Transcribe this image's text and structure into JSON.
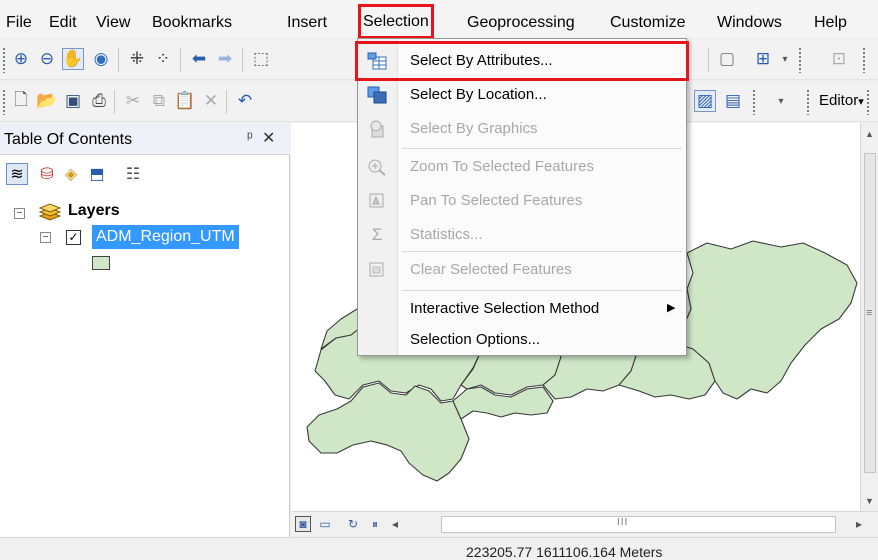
{
  "menu": {
    "items": [
      "File",
      "Edit",
      "View",
      "Bookmarks",
      "Insert",
      "Selection",
      "Geoprocessing",
      "Customize",
      "Windows",
      "Help"
    ],
    "active": "Selection"
  },
  "toolbar": {
    "editor_label": "Editor",
    "editor_arrow": "▾"
  },
  "toc": {
    "title": "Table Of Contents",
    "pin_icon": "ᵖ",
    "close_icon": "✕",
    "root_label": "Layers",
    "layer_name": "ADM_Region_UTM",
    "layer_checked": true,
    "symbol_color": "#cfe6c7"
  },
  "selection_menu": {
    "items": [
      {
        "label": "Select By Attributes...",
        "enabled": true,
        "icon": "table-select-icon",
        "highlighted": true
      },
      {
        "label": "Select By Location...",
        "enabled": true,
        "icon": "location-select-icon"
      },
      {
        "label": "Select By Graphics",
        "enabled": false,
        "icon": "graphics-select-icon"
      },
      {
        "label": "Zoom To Selected Features",
        "enabled": false,
        "icon": "zoom-selected-icon"
      },
      {
        "label": "Pan To Selected Features",
        "enabled": false,
        "icon": "pan-selected-icon"
      },
      {
        "label": "Statistics...",
        "enabled": false,
        "icon": "sigma-icon"
      },
      {
        "label": "Clear Selected Features",
        "enabled": false,
        "icon": "clear-selection-icon"
      },
      {
        "label": "Interactive Selection Method",
        "enabled": true,
        "icon": "",
        "submenu": true
      },
      {
        "label": "Selection Options...",
        "enabled": true,
        "icon": ""
      }
    ]
  },
  "map": {
    "fill_color": "#cfe6c7",
    "outline_color": "#3a3a3a"
  },
  "scroll": {
    "hscroll_grip": "III",
    "vscroll_grip": "≡"
  },
  "status": {
    "coordinates": "223205.77 1611106.164 Meters"
  },
  "colors": {
    "highlight_outline": "#e8141c",
    "layer_selection": "#3399ff"
  }
}
